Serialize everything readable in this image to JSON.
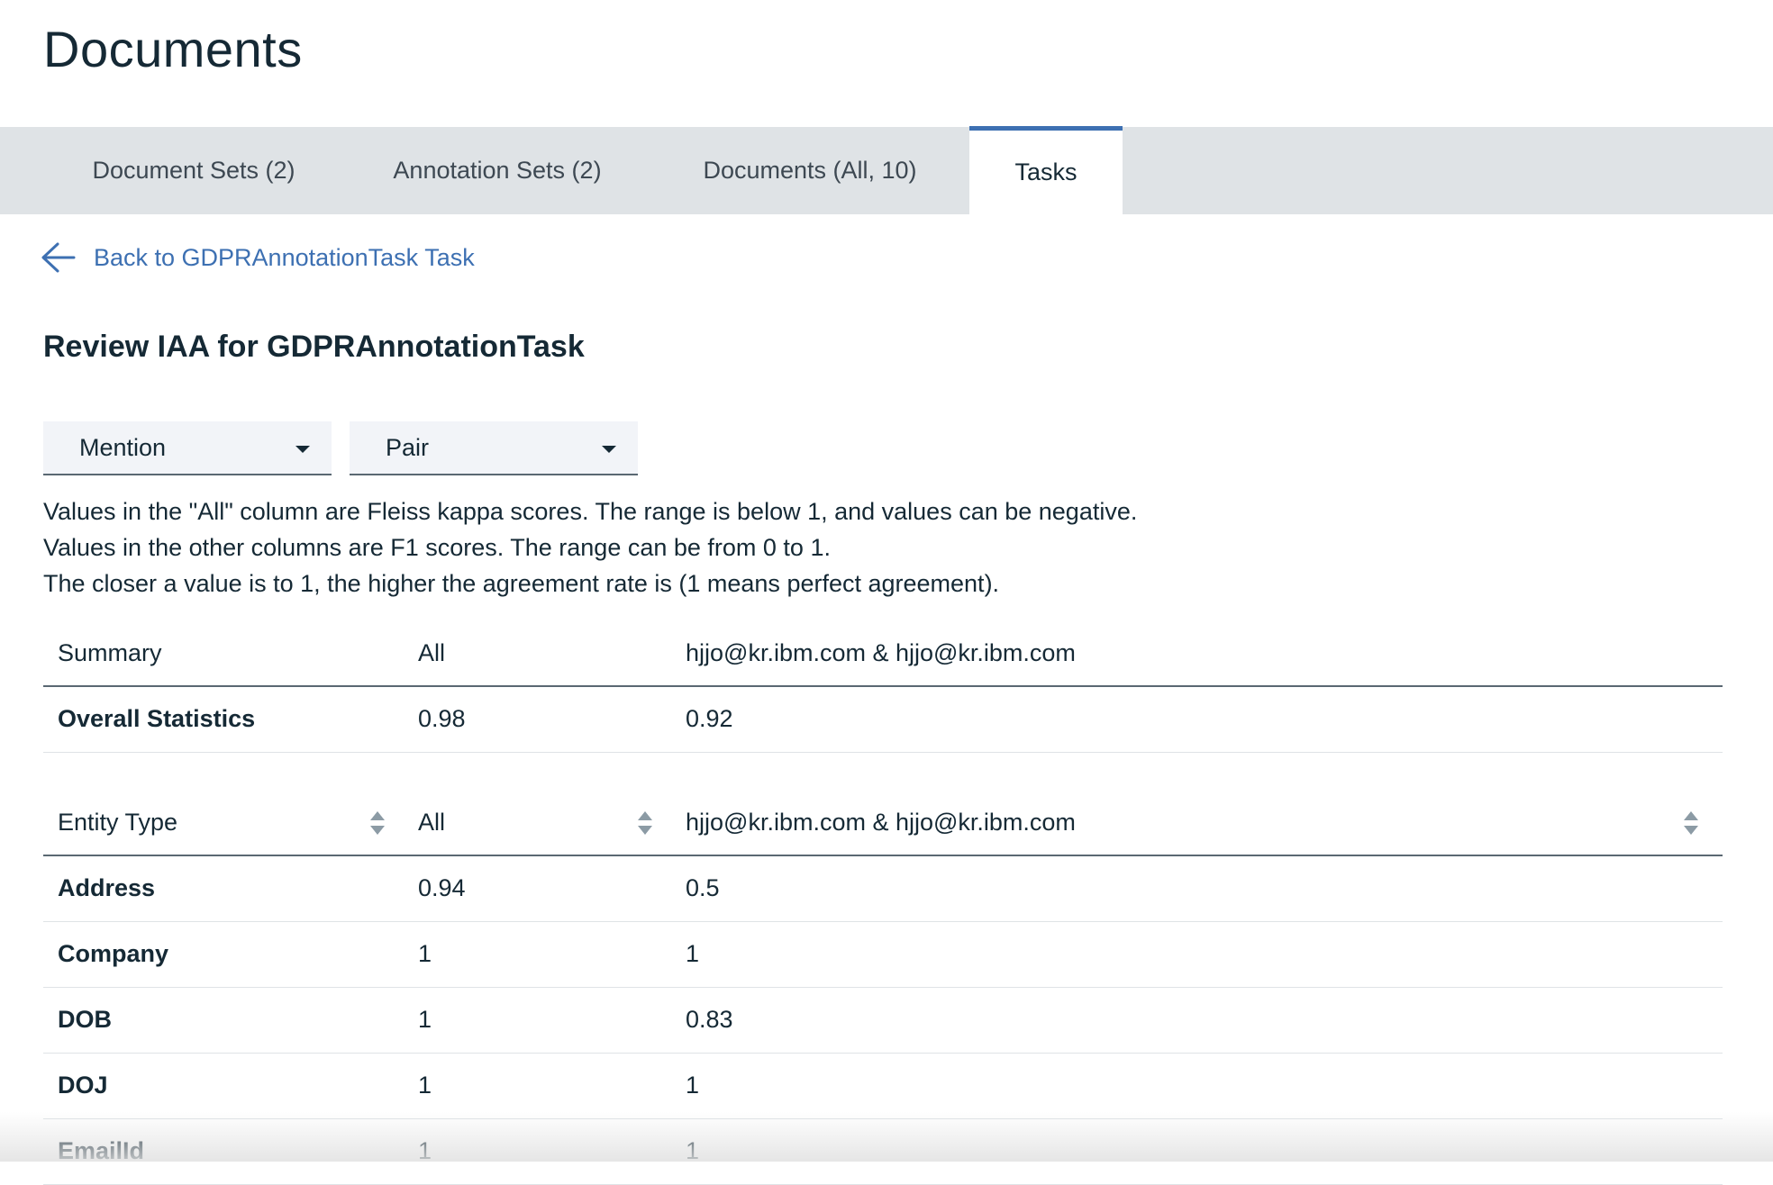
{
  "page": {
    "title": "Documents"
  },
  "tabs": [
    {
      "label": "Document Sets (2)",
      "active": false
    },
    {
      "label": "Annotation Sets (2)",
      "active": false
    },
    {
      "label": "Documents (All, 10)",
      "active": false
    },
    {
      "label": "Tasks",
      "active": true
    }
  ],
  "back_link": {
    "label": "Back to GDPRAnnotationTask Task",
    "icon": "arrow-left-icon"
  },
  "section_title": "Review IAA for GDPRAnnotationTask",
  "filters": {
    "type_select": "Mention",
    "mode_select": "Pair"
  },
  "description": [
    "Values in the \"All\" column are Fleiss kappa scores. The range is below 1, and values can be negative.",
    "Values in the other columns are F1 scores. The range can be from 0 to 1.",
    "The closer a value is to 1, the higher the agreement rate is (1 means perfect agreement)."
  ],
  "summary_table": {
    "headers": [
      "Summary",
      "All",
      "hjjo@kr.ibm.com & hjjo@kr.ibm.com"
    ],
    "rows": [
      {
        "label": "Overall Statistics",
        "all": "0.98",
        "pair": "0.92"
      }
    ]
  },
  "entity_table": {
    "headers": [
      "Entity Type",
      "All",
      "hjjo@kr.ibm.com & hjjo@kr.ibm.com"
    ],
    "rows": [
      {
        "label": "Address",
        "all": "0.94",
        "pair": "0.5"
      },
      {
        "label": "Company",
        "all": "1",
        "pair": "1"
      },
      {
        "label": "DOB",
        "all": "1",
        "pair": "0.83"
      },
      {
        "label": "DOJ",
        "all": "1",
        "pair": "1"
      },
      {
        "label": "EmailId",
        "all": "1",
        "pair": "1"
      }
    ]
  },
  "colors": {
    "accent": "#3d70b2",
    "tabbar_bg": "#dfe3e6",
    "text": "#152935"
  }
}
